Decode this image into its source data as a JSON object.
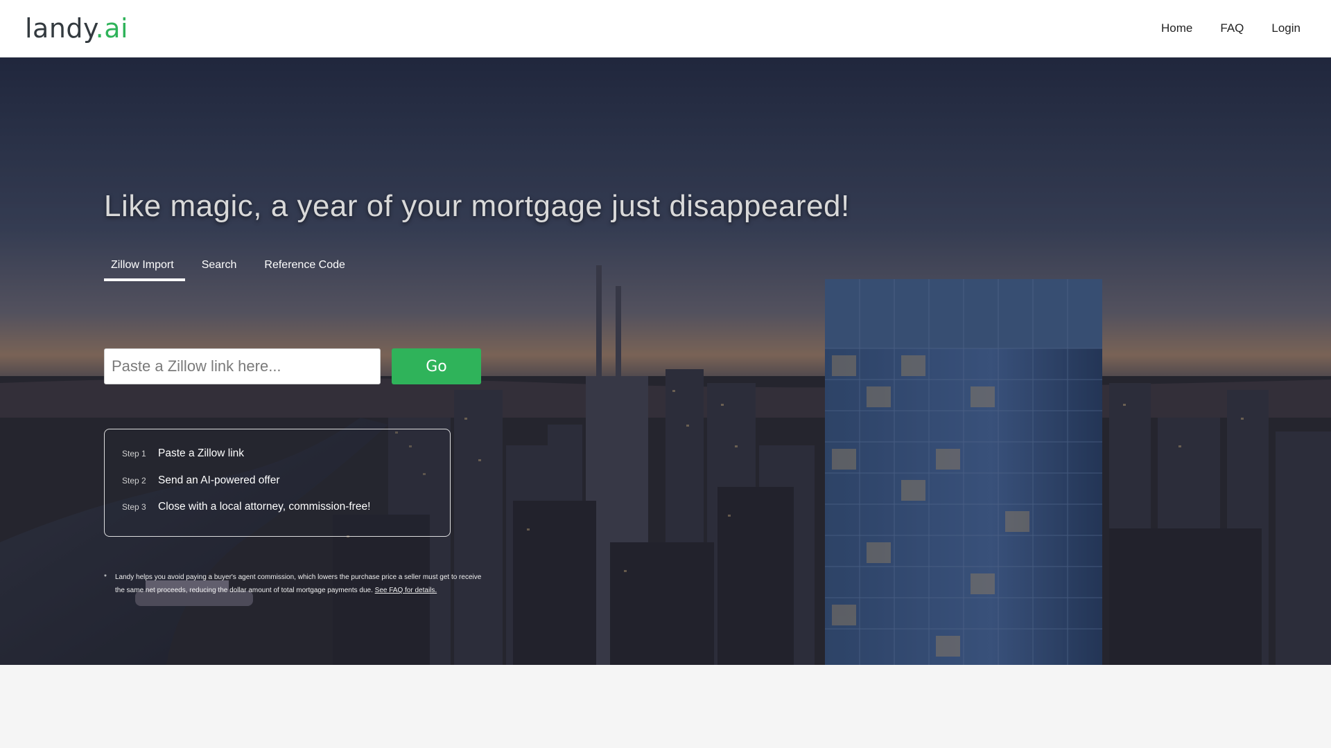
{
  "header": {
    "logo_main": "landy",
    "logo_accent": ".ai",
    "nav": [
      {
        "label": "Home"
      },
      {
        "label": "FAQ"
      },
      {
        "label": "Login"
      }
    ]
  },
  "hero": {
    "headline": "Like magic, a year of your mortgage just disappeared!",
    "tabs": [
      {
        "label": "Zillow Import",
        "active": true
      },
      {
        "label": "Search",
        "active": false
      },
      {
        "label": "Reference Code",
        "active": false
      }
    ],
    "search": {
      "placeholder": "Paste a Zillow link here...",
      "value": ""
    },
    "go_label": "Go",
    "steps": [
      {
        "num": "Step 1",
        "text": "Paste a Zillow link"
      },
      {
        "num": "Step 2",
        "text": "Send an AI-powered offer"
      },
      {
        "num": "Step 3",
        "text": "Close with a local attorney, commission-free!"
      }
    ],
    "disclaimer": {
      "star": "*",
      "text": "Landy helps you avoid paying a buyer's agent commission, which lowers the purchase price a seller must get to receive the same net proceeds, reducing the dollar amount of total mortgage payments due.",
      "link": "See FAQ for details."
    }
  },
  "colors": {
    "accent": "#2fb35a",
    "header_bg": "#ffffff",
    "page_bg": "#f5f5f5"
  }
}
